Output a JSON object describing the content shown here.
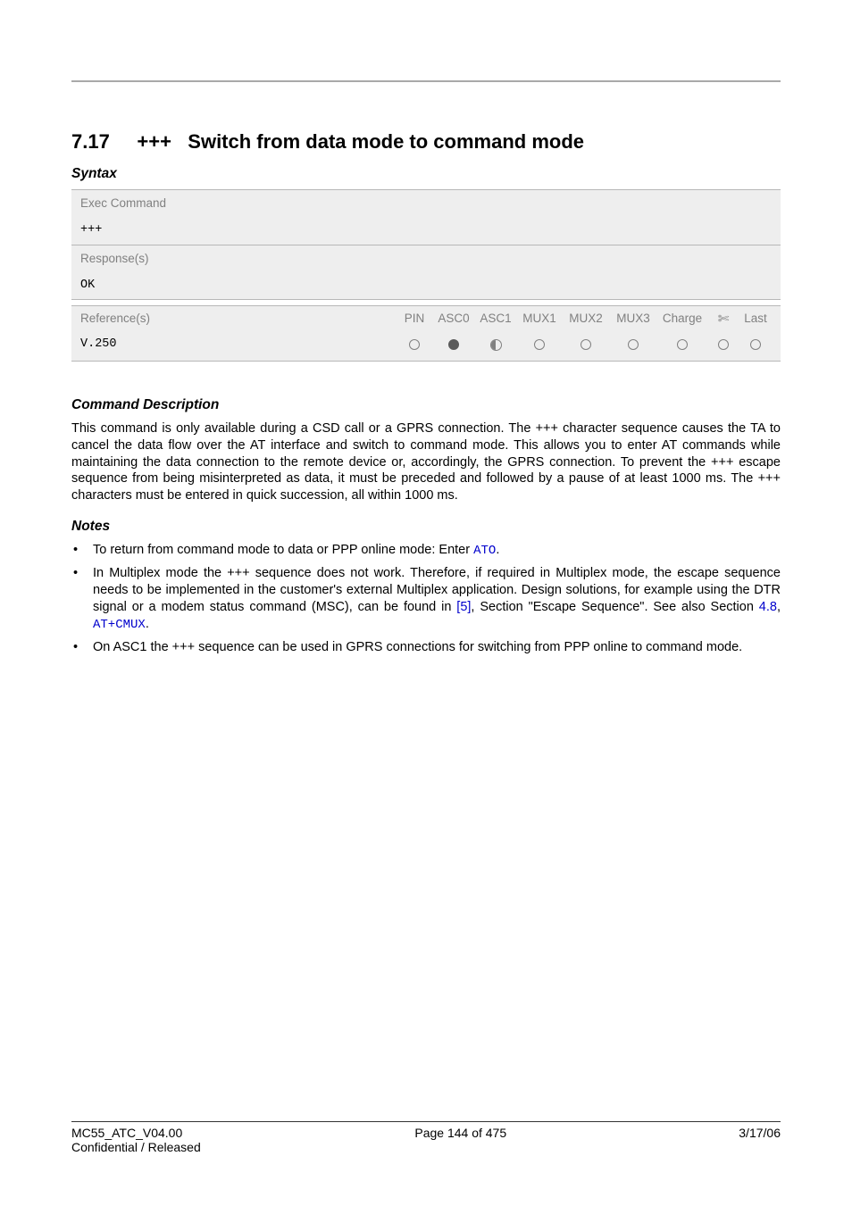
{
  "header": {
    "section_number": "7.17",
    "escape": "+++",
    "title": "Switch from data mode to command mode"
  },
  "syntax": {
    "heading": "Syntax",
    "exec_label": "Exec Command",
    "exec_cmd": "+++",
    "response_label": "Response(s)",
    "response_value": "OK",
    "ref_label": "Reference(s)",
    "ref_value": "V.250",
    "cols": {
      "pin": "PIN",
      "asc0": "ASC0",
      "asc1": "ASC1",
      "mux1": "MUX1",
      "mux2": "MUX2",
      "mux3": "MUX3",
      "charge": "Charge",
      "last": "Last"
    }
  },
  "desc": {
    "heading": "Command Description",
    "body": "This command is only available during a CSD call or a GPRS connection. The +++ character sequence causes the TA to cancel the data flow over the AT interface and switch to command mode. This allows you to enter AT commands while maintaining the data connection to the remote device or, accordingly, the GPRS connection. To prevent the +++ escape sequence from being misinterpreted as data, it must be preceded and followed by a pause of at least 1000 ms. The +++ characters must be entered in quick succession, all within 1000 ms."
  },
  "notes": {
    "heading": "Notes",
    "item1_pre": "To return from command mode to data or PPP online mode: Enter ",
    "item1_cmd": "ATO",
    "item1_post": ".",
    "item2_pre": "In Multiplex mode the +++ sequence does not work. Therefore, if required in Multiplex mode, the escape sequence needs to be implemented in the customer's external Multiplex application. Design solutions, for example using the DTR signal or a modem status command (MSC), can be found in ",
    "item2_ref": "[5]",
    "item2_mid": ", Section \"Escape Sequence\". See also Section ",
    "item2_sec": "4.8",
    "item2_sep": ", ",
    "item2_cmd": "AT+CMUX",
    "item2_post": ".",
    "item3": "On ASC1 the +++ sequence can be used in GPRS connections for switching from PPP online to command mode."
  },
  "footer": {
    "doc": "MC55_ATC_V04.00",
    "conf": "Confidential / Released",
    "page": "Page 144 of 475",
    "date": "3/17/06"
  }
}
